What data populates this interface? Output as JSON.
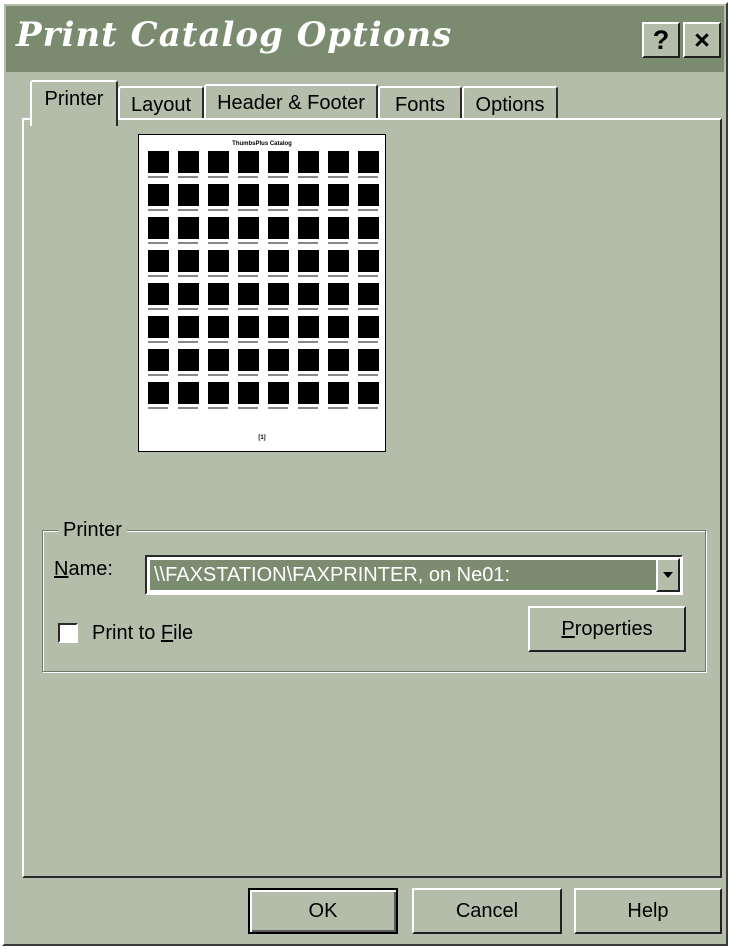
{
  "window": {
    "title": "Print Catalog Options",
    "help_glyph": "?",
    "close_glyph": "×"
  },
  "tabs": [
    {
      "label": "Printer",
      "active": true
    },
    {
      "label": "Layout",
      "active": false
    },
    {
      "label": "Header & Footer",
      "active": false
    },
    {
      "label": "Fonts",
      "active": false
    },
    {
      "label": "Options",
      "active": false
    }
  ],
  "preview": {
    "title": "ThumbsPlus Catalog",
    "page_label": "[1]",
    "rows": 8,
    "columns": 8
  },
  "printer_group": {
    "label": "Printer",
    "name_label_prefix": "",
    "name_label_mnemonic": "N",
    "name_label_rest": "ame:",
    "name_value": "\\\\FAXSTATION\\FAXPRINTER, on Ne01:",
    "print_to_file_prefix": "Print to ",
    "print_to_file_mnemonic": "F",
    "print_to_file_rest": "ile",
    "print_to_file_checked": false,
    "properties_mnemonic": "P",
    "properties_rest": "roperties"
  },
  "buttons": {
    "ok": "OK",
    "cancel": "Cancel",
    "help": "Help"
  },
  "colors": {
    "face": "#b3bda9",
    "titlebar": "#7a8b70",
    "selection": "#7b8c71"
  }
}
